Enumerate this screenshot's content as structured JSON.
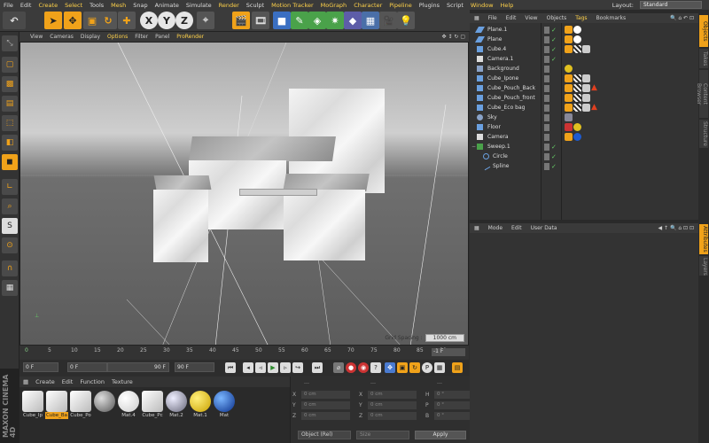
{
  "menubar": {
    "items": [
      "File",
      "Edit",
      "Create",
      "Select",
      "Tools",
      "Mesh",
      "Snap",
      "Animate",
      "Simulate",
      "Render",
      "Sculpt",
      "Motion Tracker",
      "MoGraph",
      "Character",
      "Pipeline",
      "Plugins",
      "Script",
      "Window",
      "Help"
    ],
    "layout_label": "Layout:",
    "layout_value": "Standard"
  },
  "viewport": {
    "menu": [
      "View",
      "Cameras",
      "Display",
      "Options",
      "Filter",
      "Panel",
      "ProRender"
    ],
    "grid_spacing_label": "Grid Spacing :",
    "grid_spacing_value": "1000 cm"
  },
  "timeline": {
    "start": "0",
    "ticks": [
      "5",
      "10",
      "15",
      "20",
      "25",
      "30",
      "35",
      "40",
      "45",
      "50",
      "55",
      "60",
      "65",
      "70",
      "75",
      "80",
      "85",
      "90"
    ],
    "current_frame": "-1 F"
  },
  "playback": {
    "field1": "0 F",
    "field2": "0 F",
    "field3": "90 F",
    "field4": "90 F"
  },
  "material_manager": {
    "menu": [
      "Create",
      "Edit",
      "Function",
      "Texture"
    ],
    "materials": [
      {
        "name": "Cube_Ip",
        "ball": "cube-white",
        "selected": false
      },
      {
        "name": "Cube_Ba",
        "ball": "cube-white",
        "selected": true
      },
      {
        "name": "Cube_Po",
        "ball": "cube-white",
        "selected": false
      },
      {
        "name": "",
        "ball": "grey",
        "selected": false
      },
      {
        "name": "Mat.4",
        "ball": "white",
        "selected": false
      },
      {
        "name": "Cube_Pc",
        "ball": "cube-white",
        "selected": false
      },
      {
        "name": "Mat.2",
        "ball": "glass",
        "selected": false
      },
      {
        "name": "Mat.1",
        "ball": "yellow",
        "selected": false
      },
      {
        "name": "Mat",
        "ball": "blue",
        "selected": false
      }
    ]
  },
  "coordinates": {
    "header": [
      "---",
      "---",
      "---"
    ],
    "rows": [
      {
        "a": "X",
        "av": "0 cm",
        "b": "X",
        "bv": "0 cm",
        "c": "H",
        "cv": "0 °"
      },
      {
        "a": "Y",
        "av": "0 cm",
        "b": "Y",
        "bv": "0 cm",
        "c": "P",
        "cv": "0 °"
      },
      {
        "a": "Z",
        "av": "0 cm",
        "b": "Z",
        "bv": "0 cm",
        "c": "B",
        "cv": "0 °"
      }
    ],
    "mode": "Object (Rel)",
    "size_mode": "Size",
    "apply": "Apply"
  },
  "object_manager": {
    "menu": [
      "File",
      "Edit",
      "View",
      "Objects",
      "Tags",
      "Bookmarks"
    ],
    "objects": [
      {
        "name": "Plane.1",
        "indent": 0
      },
      {
        "name": "Plane",
        "indent": 0
      },
      {
        "name": "Cube.4",
        "indent": 0
      },
      {
        "name": "Camera.1",
        "indent": 0
      },
      {
        "name": "Background",
        "indent": 0
      },
      {
        "name": "Cube_Ipone",
        "indent": 0
      },
      {
        "name": "Cube_Pouch_Back",
        "indent": 0
      },
      {
        "name": "Cube_Pouch_front",
        "indent": 0
      },
      {
        "name": "Cube_Eco bag",
        "indent": 0
      },
      {
        "name": "Sky",
        "indent": 0
      },
      {
        "name": "Floor",
        "indent": 0
      },
      {
        "name": "Camera",
        "indent": 0
      },
      {
        "name": "Sweep.1",
        "indent": 0
      },
      {
        "name": "Circle",
        "indent": 1
      },
      {
        "name": "Spline",
        "indent": 1
      }
    ]
  },
  "attributes": {
    "menu": [
      "Mode",
      "Edit",
      "User Data"
    ]
  },
  "right_tabs": [
    "Objects",
    "Takes",
    "Content Browser",
    "Structure",
    "Attributes",
    "Layers"
  ],
  "branding": "MAXON CINEMA 4D",
  "colors": {
    "accent": "#f0a21a",
    "highlight_menu": "#ffd24a",
    "panel": "#333333"
  }
}
